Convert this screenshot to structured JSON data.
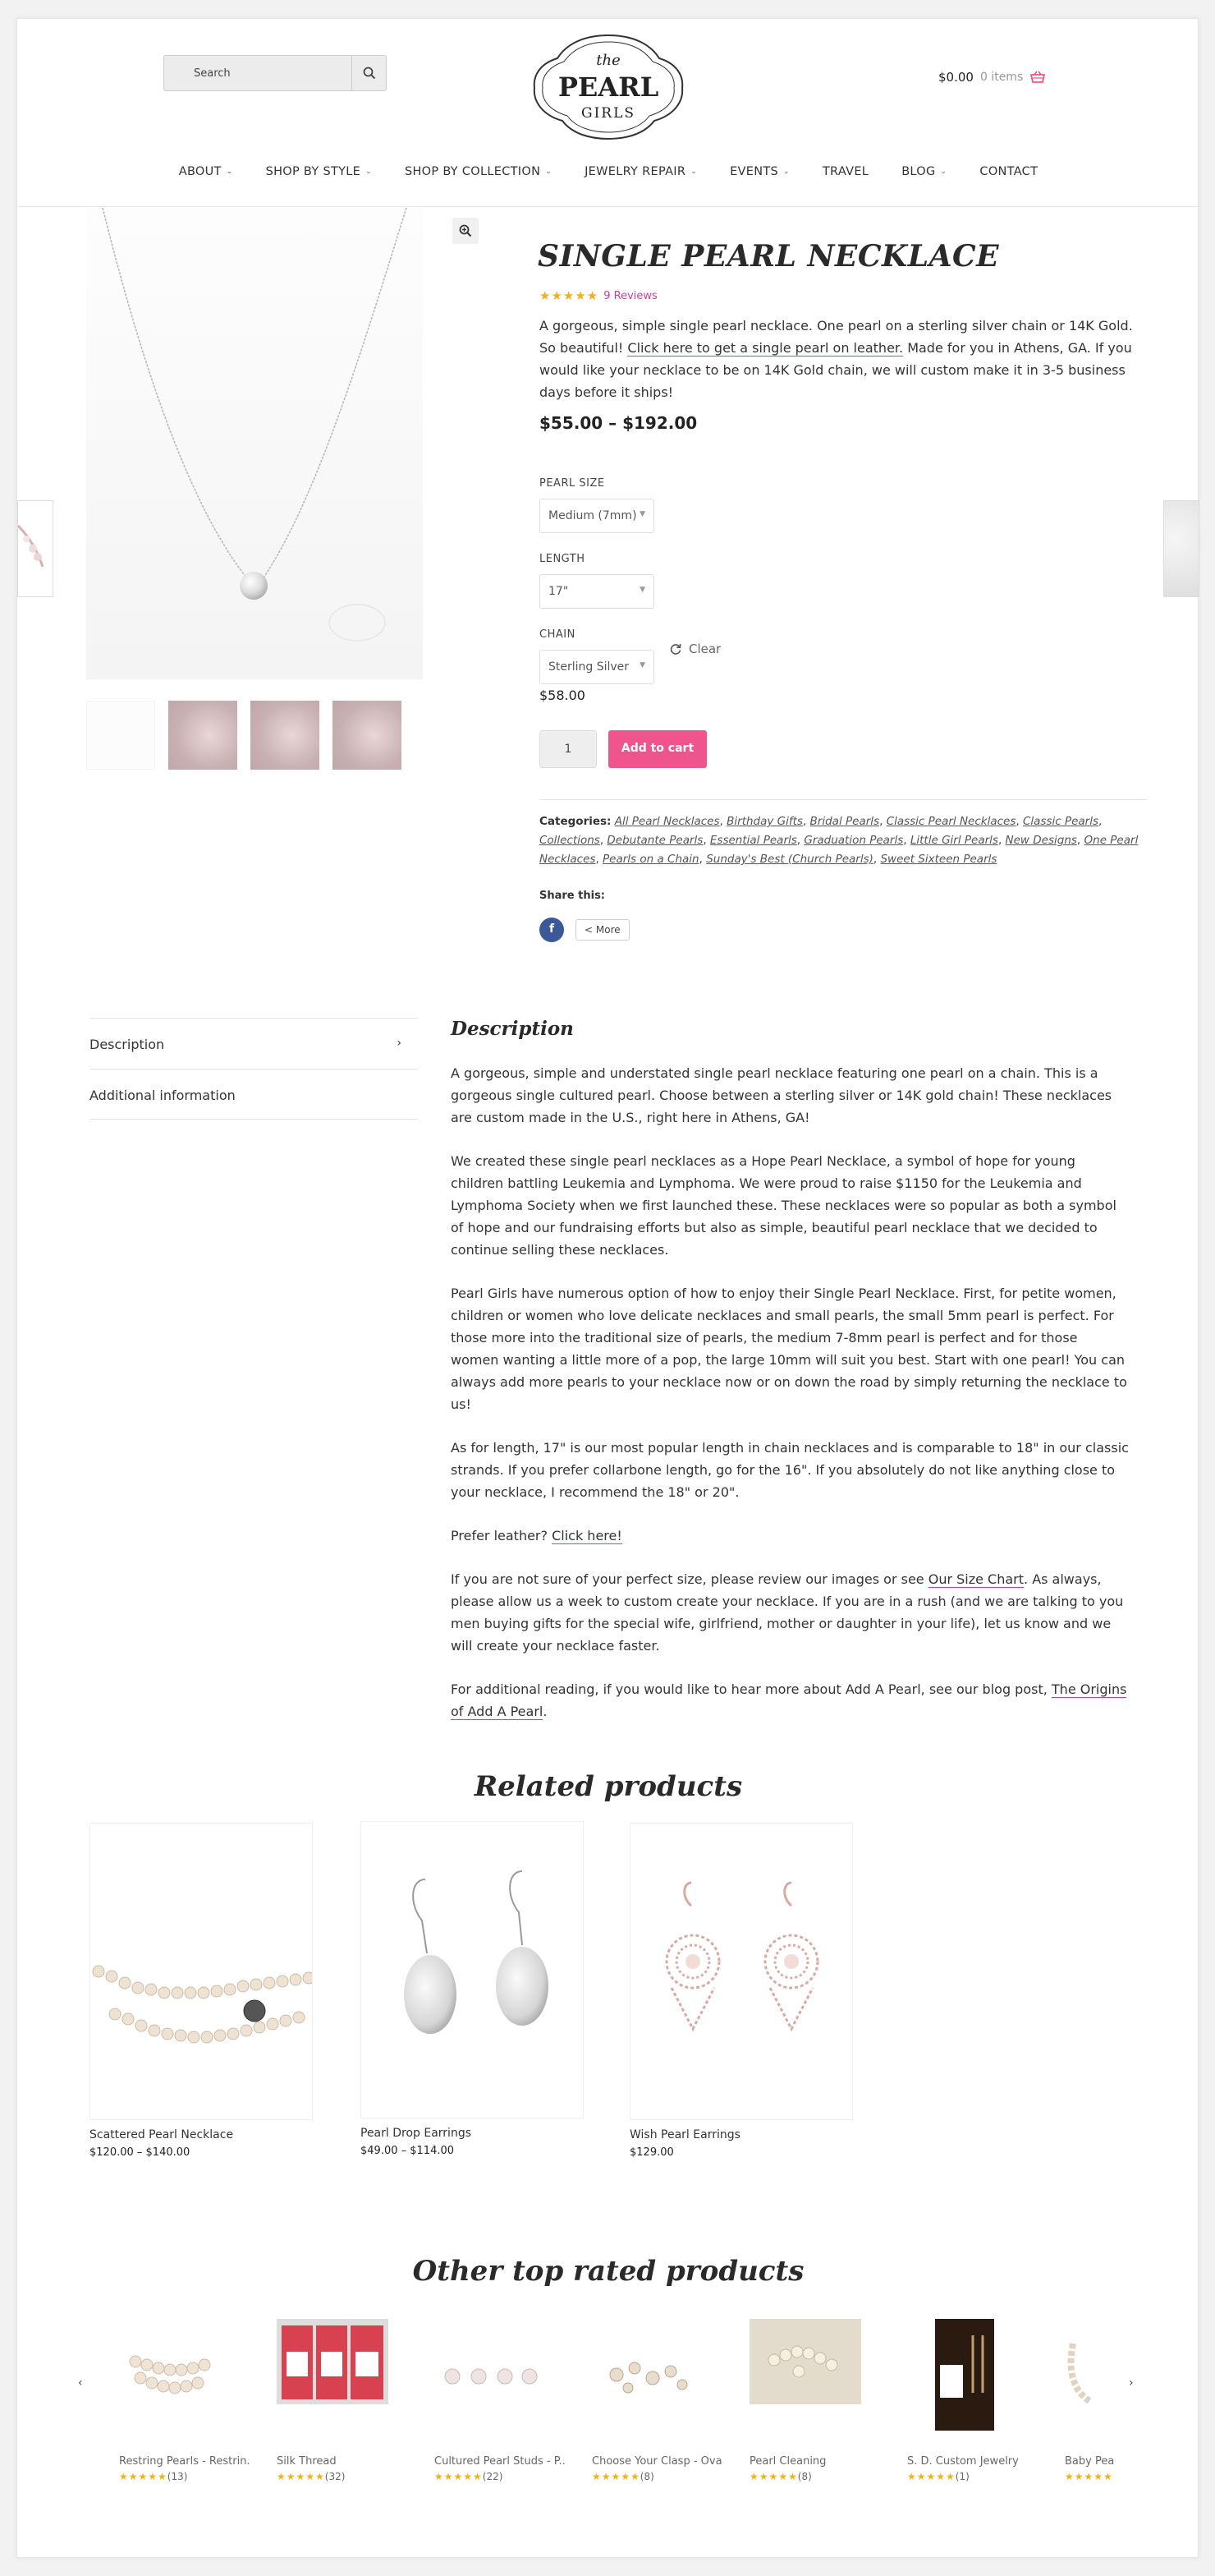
{
  "header": {
    "search_placeholder": "Search",
    "cart_total": "$0.00",
    "cart_items": "0 items",
    "logo_small": "the",
    "logo_main": "PEARL",
    "logo_sub": "GIRLS"
  },
  "nav": [
    {
      "label": "ABOUT",
      "dropdown": true
    },
    {
      "label": "SHOP BY STYLE",
      "dropdown": true
    },
    {
      "label": "SHOP BY COLLECTION",
      "dropdown": true
    },
    {
      "label": "JEWELRY REPAIR",
      "dropdown": true
    },
    {
      "label": "EVENTS",
      "dropdown": true
    },
    {
      "label": "TRAVEL",
      "dropdown": false
    },
    {
      "label": "BLOG",
      "dropdown": true
    },
    {
      "label": "CONTACT",
      "dropdown": false
    }
  ],
  "product": {
    "title": "SINGLE PEARL NECKLACE",
    "stars": "★★★★★",
    "reviews": "9 Reviews",
    "desc_1": "A gorgeous, simple single pearl necklace. One pearl on a sterling silver chain or 14K Gold. So beautiful!  ",
    "desc_link": "Click here to get a single pearl on leather.",
    "desc_2": " Made for you in Athens, GA. If you would like your necklace to be on 14K Gold chain, we will custom make it in 3-5 business days before it ships!",
    "price_range": "$55.00 – $192.00",
    "pearl_size_label": "PEARL SIZE",
    "pearl_size_value": "Medium (7mm)",
    "length_label": "LENGTH",
    "length_value": "17\"",
    "chain_label": "CHAIN",
    "chain_value": "Sterling Silver",
    "clear_label": "Clear",
    "variation_price": "$58.00",
    "quantity": "1",
    "add_to_cart": "Add to cart",
    "categories_label": "Categories:",
    "categories": [
      "All Pearl Necklaces",
      "Birthday Gifts",
      "Bridal Pearls",
      "Classic Pearl Necklaces",
      "Classic Pearls",
      "Collections",
      "Debutante Pearls",
      "Essential Pearls",
      "Graduation Pearls",
      "Little Girl Pearls",
      "New Designs",
      "One Pearl Necklaces",
      "Pearls on a Chain",
      "Sunday's Best (Church Pearls)",
      "Sweet Sixteen Pearls"
    ],
    "share_label": "Share this:",
    "share_fb": "f",
    "share_more": "More"
  },
  "tabs": [
    {
      "label": "Description",
      "active": true
    },
    {
      "label": "Additional information",
      "active": false
    }
  ],
  "description": {
    "title": "Description",
    "p1": "A gorgeous, simple and understated single pearl necklace featuring one pearl on a chain. This is a gorgeous single cultured pearl. Choose between a sterling silver or 14K gold chain! These necklaces are custom made in the U.S., right here in Athens, GA!",
    "p2": "We created these single pearl necklaces as a Hope Pearl Necklace, a symbol of hope for young children battling Leukemia and Lymphoma. We were proud to raise $1150 for the Leukemia and Lymphoma Society when we first launched these. These necklaces were so popular as both a symbol of hope and our fundraising efforts but also as simple, beautiful pearl necklace that we decided to continue selling these necklaces.",
    "p3": "Pearl Girls have numerous option of how to enjoy their Single Pearl Necklace. First, for petite women, children or women who love delicate necklaces and small pearls, the small 5mm pearl is perfect. For those more into the traditional size of pearls, the medium 7-8mm pearl is perfect and for those women wanting a little more of a pop, the large 10mm will suit you best. Start with one pearl! You can always add more pearls to your necklace now or on down the road by simply returning the necklace to us!",
    "p4": "As for length, 17\" is our most popular length in chain necklaces and is comparable to 18\" in our classic strands. If you prefer collarbone length, go for the 16\". If you absolutely do not like anything close to your necklace, I recommend the 18\" or 20\".",
    "p5_text": "Prefer leather? ",
    "p5_link": "Click here!",
    "p6_a": "If you are not sure of your perfect size, please review our images or see ",
    "p6_link": "Our Size Chart",
    "p6_b": ".  As always, please allow us a week to custom create your necklace. If you are in a rush (and we are talking to you men buying gifts for the special wife, girlfriend, mother or daughter in your life), let us know and we will create your necklace faster.",
    "p7_a": "For additional reading, if you would like to hear more about Add A Pearl, see our blog post, ",
    "p7_link": "The Origins of Add A Pearl",
    "p7_b": "."
  },
  "related": {
    "title": "Related products",
    "items": [
      {
        "name": "Scattered Pearl Necklace",
        "price": "$120.00 – $140.00"
      },
      {
        "name": "Pearl Drop Earrings",
        "price": "$49.00 – $114.00"
      },
      {
        "name": "Wish Pearl Earrings",
        "price": "$129.00"
      }
    ]
  },
  "top_rated": {
    "title": "Other top rated products",
    "items": [
      {
        "name": "Restring Pearls - Restrin...",
        "count": "(13)"
      },
      {
        "name": "Silk Thread",
        "count": "(32)"
      },
      {
        "name": "Cultured Pearl Studs - P...",
        "count": "(22)"
      },
      {
        "name": "Choose Your Clasp - Ova...",
        "count": "(8)"
      },
      {
        "name": "Pearl Cleaning",
        "count": "(8)"
      },
      {
        "name": "S. D. Custom Jewelry",
        "count": "(1)"
      },
      {
        "name": "Baby Pea",
        "count": ""
      }
    ],
    "stars": "★★★★★"
  },
  "colors": {
    "accent_pink": "#f0548c",
    "review_pink": "#e0378c",
    "star_gold": "#f2b01e",
    "facebook_blue": "#3b5998"
  }
}
